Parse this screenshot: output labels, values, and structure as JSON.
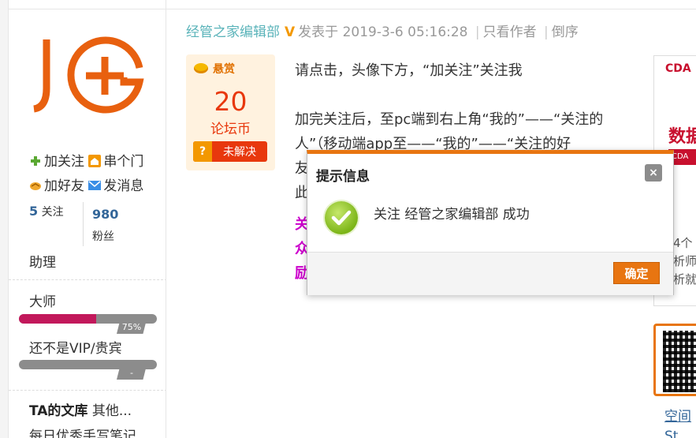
{
  "sidebar": {
    "logo_text": "JG+",
    "links": {
      "follow": "加关注",
      "visit": "串个门",
      "add_friend": "加好友",
      "message": "发消息"
    },
    "stats": {
      "following_count": "5",
      "following_label": "关注",
      "fans_count": "980",
      "fans_label": "粉丝"
    },
    "role": "助理",
    "levels": [
      {
        "title": "大师",
        "percent_label": "75%",
        "progress": 0.75
      },
      {
        "title": "还不是VIP/贵宾",
        "percent_label": "-",
        "progress": 0
      }
    ],
    "wenku_title": "TA的文库",
    "wenku_more": "其他...",
    "wenku_item": "每日优秀手写笔记"
  },
  "post": {
    "author": "经管之家编辑部",
    "posted_at": "发表于 2019-3-6 05:16:28",
    "only_author": "只看作者",
    "reverse": "倒序",
    "sep": "|",
    "reward": {
      "header": "悬赏",
      "amount": "20",
      "unit": "论坛币",
      "status_icon": "?",
      "status": "未解决"
    },
    "body": {
      "p1": "请点击，头像下方，“加关注”关注我",
      "p2a": "加完关注后，至pc端到右上角“我的”——“关注的",
      "p2b": "人”（移动端app至——“我的”——“关注的好",
      "p2c": "友",
      "p2d": "此",
      "hl1": "关",
      "hl2": "众",
      "hl3": "励）"
    }
  },
  "ad": {
    "brand": "CDA",
    "headline": "数据",
    "badge": "CDA",
    "text1": "4个",
    "text2": "析师",
    "text3": "析就"
  },
  "qr": {
    "link": "空间",
    "link2": "St"
  },
  "dialog": {
    "title": "提示信息",
    "close": "×",
    "message": "关注 经管之家编辑部 成功",
    "ok": "确定"
  }
}
